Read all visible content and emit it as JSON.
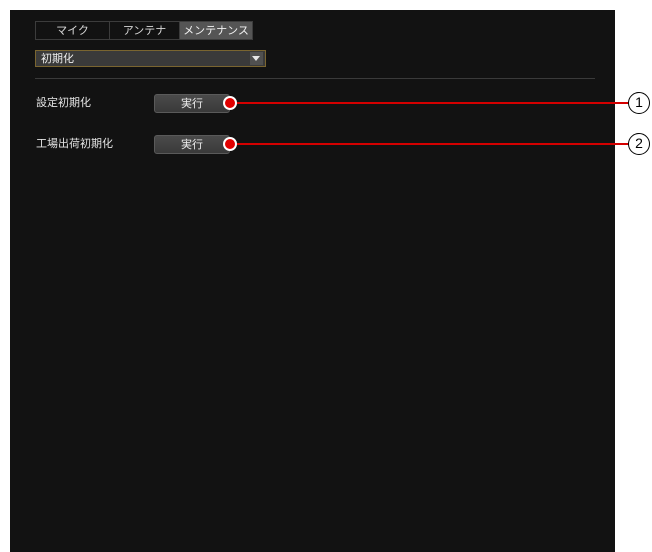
{
  "tabs": [
    {
      "label": "マイク",
      "active": false
    },
    {
      "label": "アンテナ",
      "active": false
    },
    {
      "label": "メンテナンス",
      "active": true
    }
  ],
  "dropdown": {
    "value": "初期化"
  },
  "rows": [
    {
      "label": "設定初期化",
      "button": "実行"
    },
    {
      "label": "工場出荷初期化",
      "button": "実行"
    }
  ],
  "callouts": [
    "1",
    "2"
  ],
  "colors": {
    "panel": "#121212",
    "callout": "#e00000",
    "dropdown_border": "#7a6530"
  }
}
